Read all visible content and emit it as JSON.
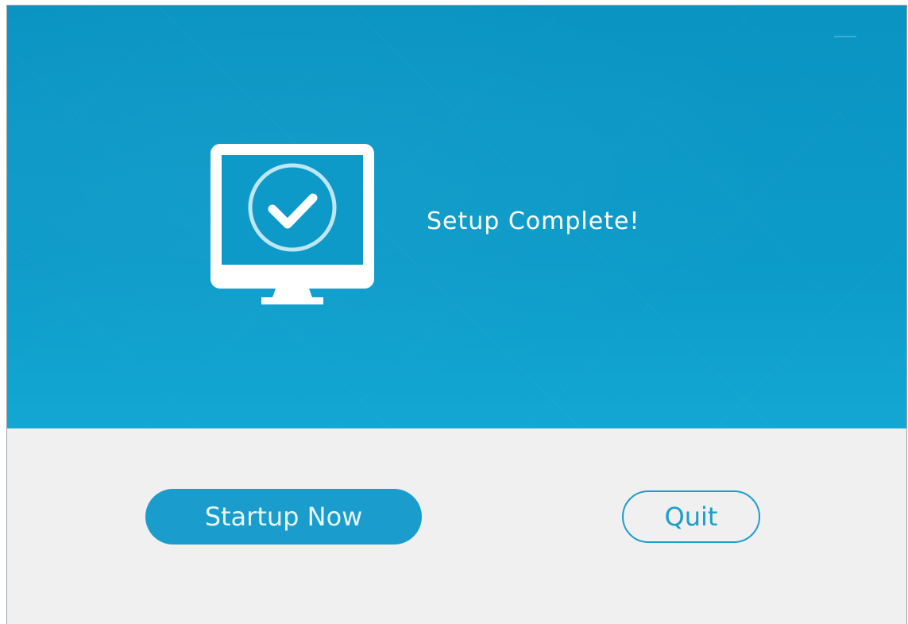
{
  "window": {
    "controls": {
      "minimize_icon": "minimize-icon"
    }
  },
  "hero": {
    "icon": "monitor-check-icon",
    "title": "Setup Complete!"
  },
  "footer": {
    "primary_button_label": "Startup Now",
    "secondary_button_label": "Quit"
  },
  "colors": {
    "hero_background": "#0c9bc9",
    "footer_background": "#f0f0f0",
    "accent": "#1a9dcc",
    "title_text": "#ffffff"
  }
}
